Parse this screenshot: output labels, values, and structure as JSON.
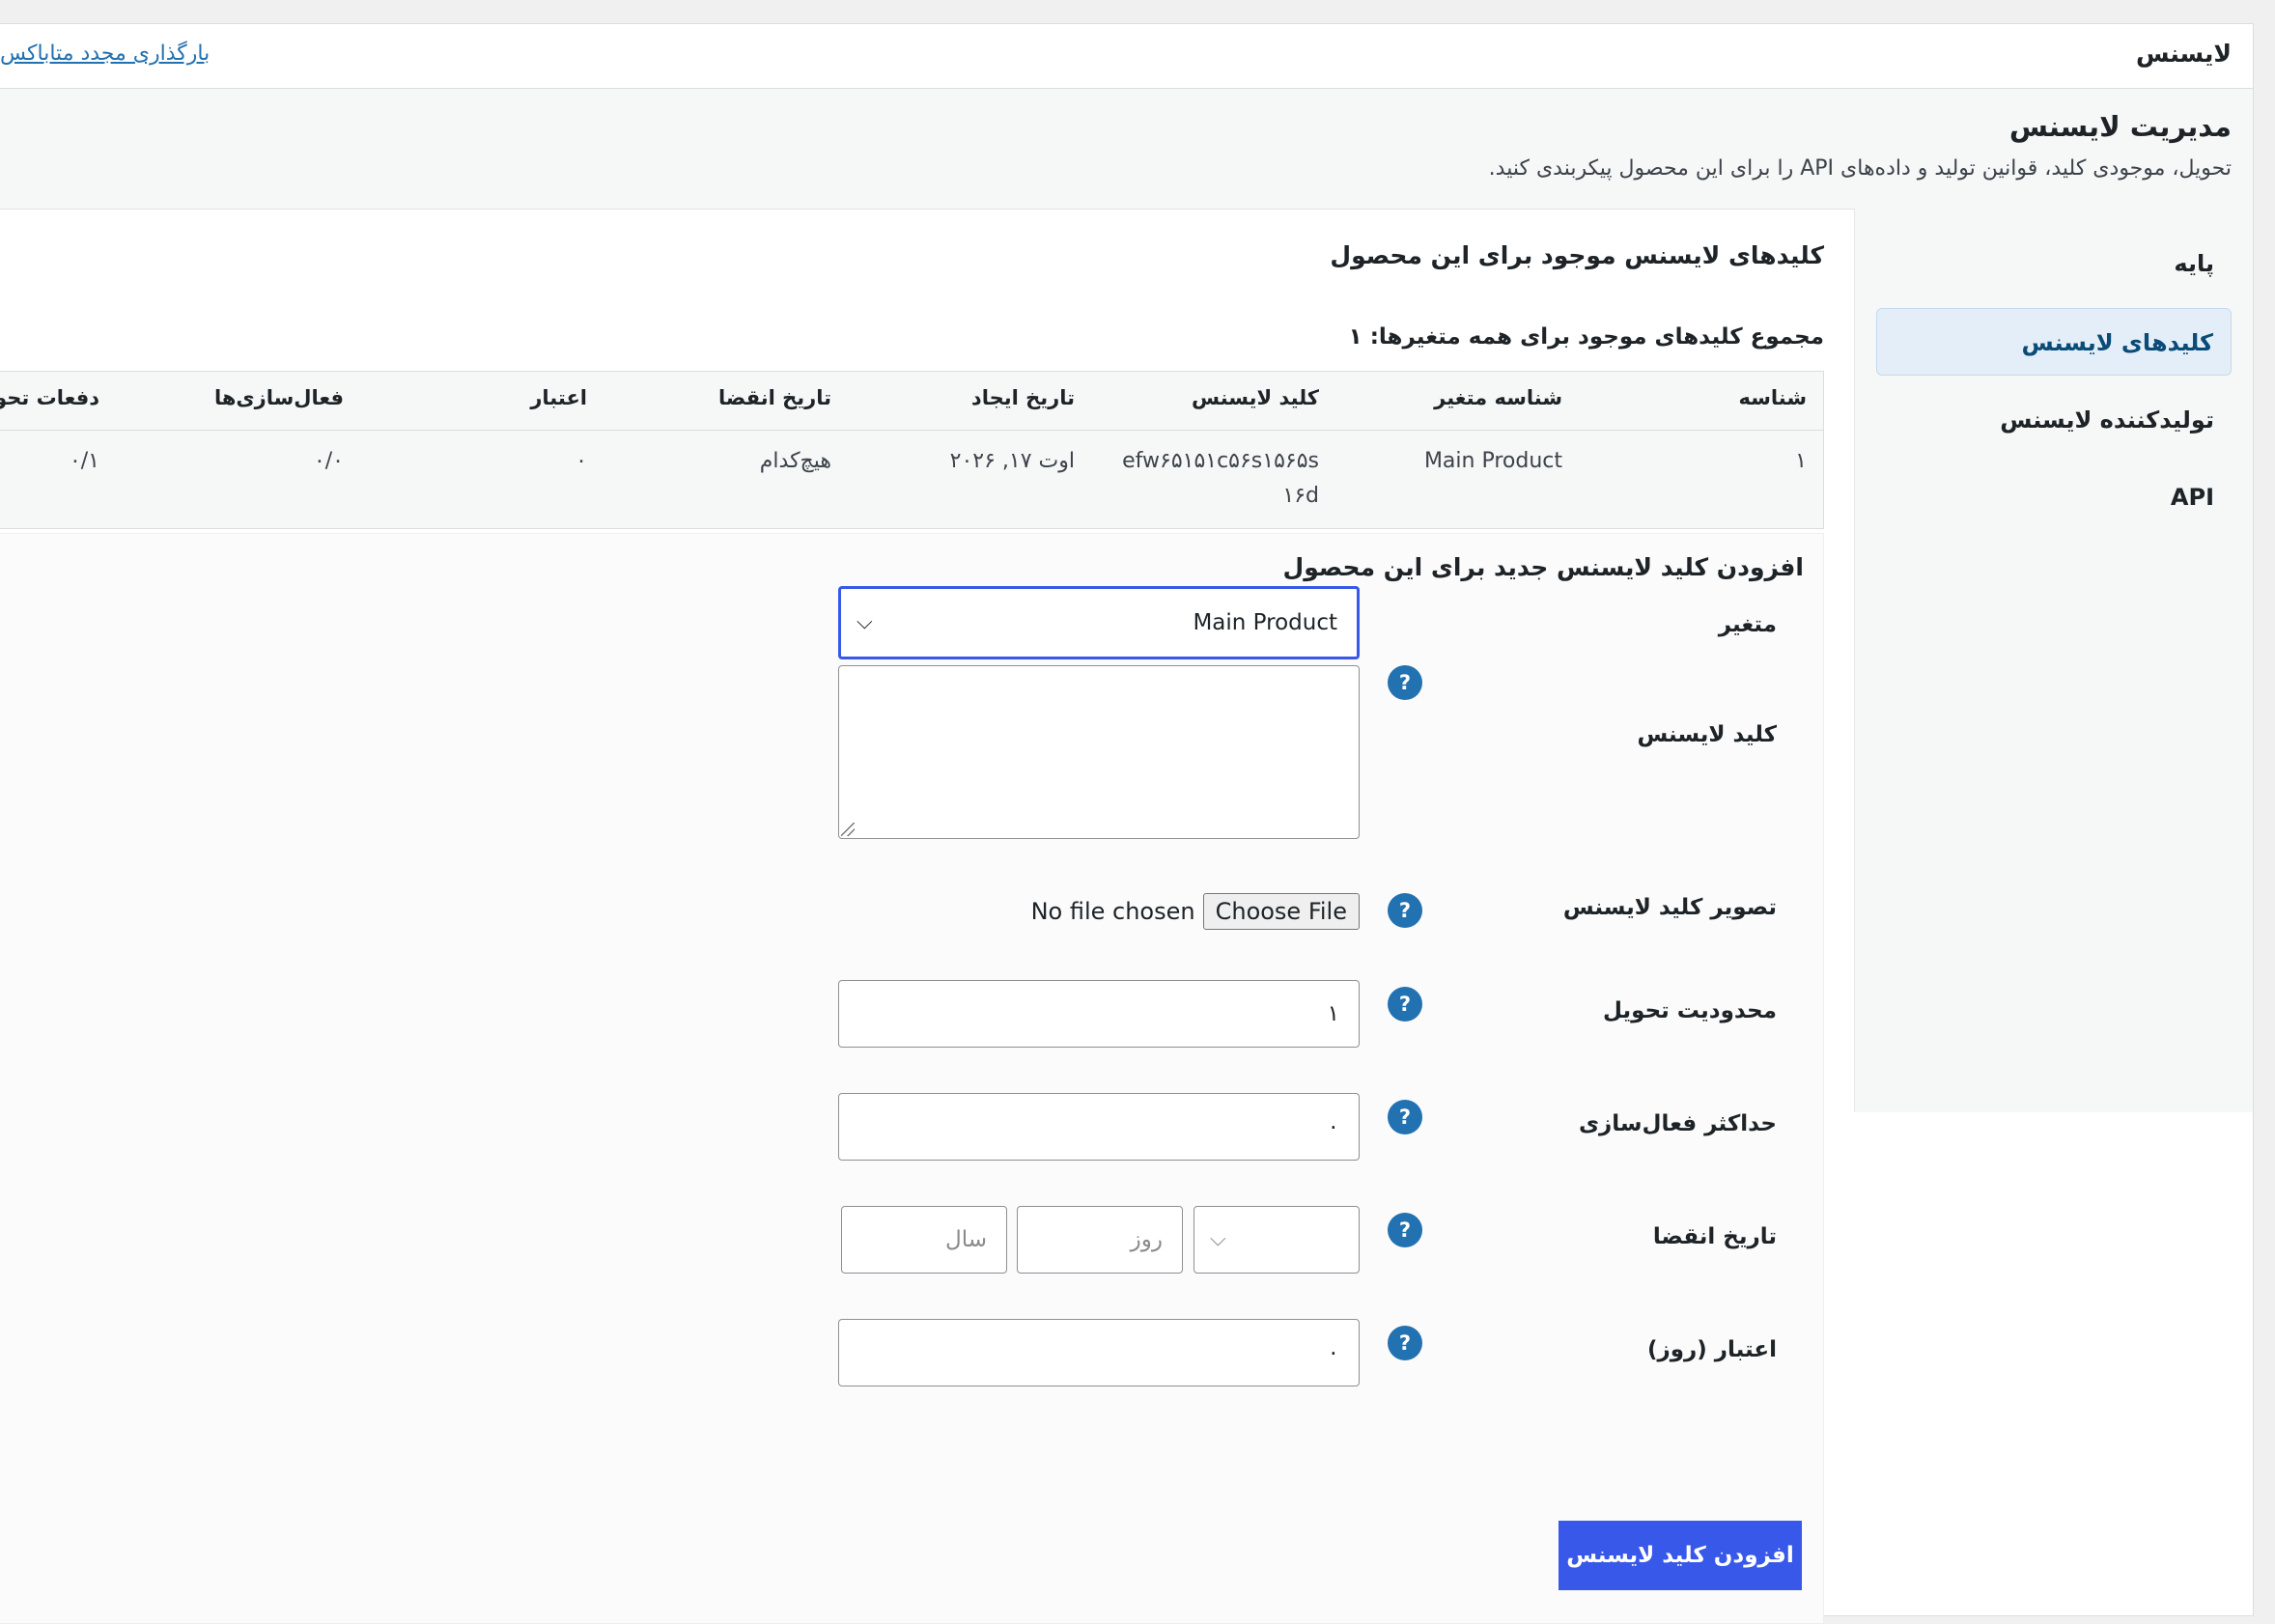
{
  "header": {
    "title": "لایسنس",
    "reload_link": "بارگذاری مجدد متاباکس"
  },
  "manage": {
    "title": "مدیریت لایسنس",
    "description": "تحویل، موجودی کلید، قوانین تولید و داده‌های API را برای این محصول پیکربندی کنید."
  },
  "sidebar": {
    "items": [
      {
        "label": "پایه"
      },
      {
        "label": "کلیدهای لایسنس"
      },
      {
        "label": "تولیدکننده لایسنس"
      },
      {
        "label": "API"
      }
    ]
  },
  "keys": {
    "section_title": "کلیدهای لایسنس موجود برای این محصول",
    "total_label": "مجموع کلیدهای موجود برای همه متغیرها: ۱",
    "columns": [
      "شناسه",
      "شناسه متغیر",
      "کلید لایسنس",
      "تاریخ ایجاد",
      "تاریخ انقضا",
      "اعتبار",
      "فعال‌سازی‌ها",
      "دفعات تحویل"
    ],
    "row": {
      "id": "۱",
      "variation": "Main Product",
      "key_line1": "efw۶۵۱۵۱c۵۶s۱۵۶۵s",
      "key_line2": "۱۶d",
      "created": "اوت ۱۷, ۲۰۲۶",
      "expires": "هیچ‌کدام",
      "validity": "۰",
      "activations": "۰/۰",
      "deliveries": "۰/۱"
    }
  },
  "form": {
    "title": "افزودن کلید لایسنس جدید برای این محصول",
    "variation_label": "متغیر",
    "variation_value": "Main Product",
    "license_key_label": "کلید لایسنس",
    "image_label": "تصویر کلید لایسنس",
    "choose_file": "Choose File",
    "no_file": "No file chosen",
    "delivery_limit_label": "محدودیت تحویل",
    "delivery_limit_value": "۱",
    "max_activation_label": "حداکثر فعال‌سازی",
    "max_activation_value": "۰",
    "expiry_label": "تاریخ انقضا",
    "day_placeholder": "روز",
    "year_placeholder": "سال",
    "validity_label": "اعتبار (روز)",
    "validity_value": "۰",
    "submit": "افزودن کلید لایسنس",
    "help": "?"
  }
}
